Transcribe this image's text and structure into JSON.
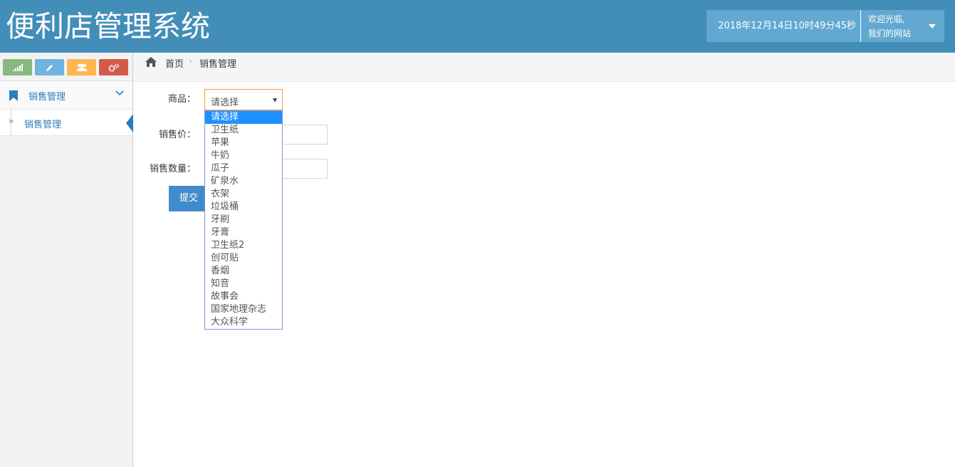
{
  "header": {
    "brand": "便利店管理系统",
    "datetime": "2018年12月14日10时49分45秒",
    "welcome_line1": "欢迎光临,",
    "welcome_line2": "我们的网站"
  },
  "sidebar": {
    "shortcuts": [
      {
        "icon": "signal-icon",
        "color": "#87b87f"
      },
      {
        "icon": "pencil-icon",
        "color": "#6fb3e0"
      },
      {
        "icon": "users-icon",
        "color": "#ffb752"
      },
      {
        "icon": "cogs-icon",
        "color": "#d15b47"
      }
    ],
    "menu": {
      "label": "销售管理"
    },
    "submenu": {
      "label": "销售管理"
    }
  },
  "breadcrumb": {
    "home": "首页",
    "current": "销售管理"
  },
  "form": {
    "product_label": "商品：",
    "product_selected": "请选择",
    "price_label": "销售价：",
    "price_value": "",
    "quantity_label": "销售数量：",
    "quantity_value": "",
    "submit_label": "提交"
  },
  "dropdown": {
    "options": [
      "请选择",
      "卫生纸",
      "苹果",
      "牛奶",
      "瓜子",
      "矿泉水",
      "衣架",
      "垃圾桶",
      "牙刷",
      "牙膏",
      "卫生纸2",
      "创可贴",
      "香烟",
      "知音",
      "故事会",
      "国家地理杂志",
      "大众科学"
    ]
  },
  "colors": {
    "navbar": "#438eb9",
    "accent": "#2b7dbc",
    "select_highlight": "#1e90ff",
    "submit": "#428bca"
  }
}
